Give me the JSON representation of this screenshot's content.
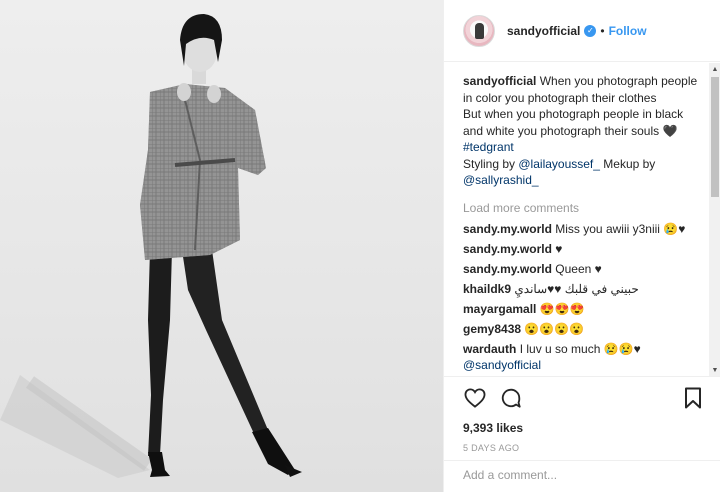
{
  "post": {
    "username": "sandyofficial",
    "dot": "•",
    "follow_label": "Follow",
    "caption": {
      "username": "sandyofficial",
      "line1": "When you photograph people in color you photograph their clothes",
      "line2": "But when you photograph people in black and white you photograph their souls 🖤",
      "hashtag": "#tedgrant",
      "styling_prefix": "Styling by",
      "styling_handle": "@lailayoussef_",
      "makeup_prefix": "Mekup by",
      "makeup_handle": "@sallyrashid_"
    },
    "load_more": "Load more comments",
    "comments": [
      {
        "user": "sandy.my.world",
        "text": "Miss you awiii y3niii 😢♥"
      },
      {
        "user": "sandy.my.world",
        "text": "♥"
      },
      {
        "user": "sandy.my.world",
        "text": "Queen ♥"
      },
      {
        "user": "khaildk9",
        "text": "حبيني في قلبك ♥♥سانديِ"
      },
      {
        "user": "mayargamall",
        "text": "😍😍😍"
      },
      {
        "user": "gemy8438",
        "text": "😮😮😮😮"
      },
      {
        "user": "wardauth",
        "text": "I luv u so much 😢😢♥"
      }
    ],
    "comment_mention": "@sandyofficial",
    "likes": "9,393 likes",
    "time": "5 DAYS AGO",
    "add_comment_placeholder": "Add a comment..."
  },
  "icons": {
    "heart": "heart-icon",
    "comment": "comment-icon",
    "save": "bookmark-icon",
    "verified": "verified-badge-icon"
  },
  "colors": {
    "link": "#003569",
    "follow": "#3897f0",
    "muted": "#999999"
  }
}
